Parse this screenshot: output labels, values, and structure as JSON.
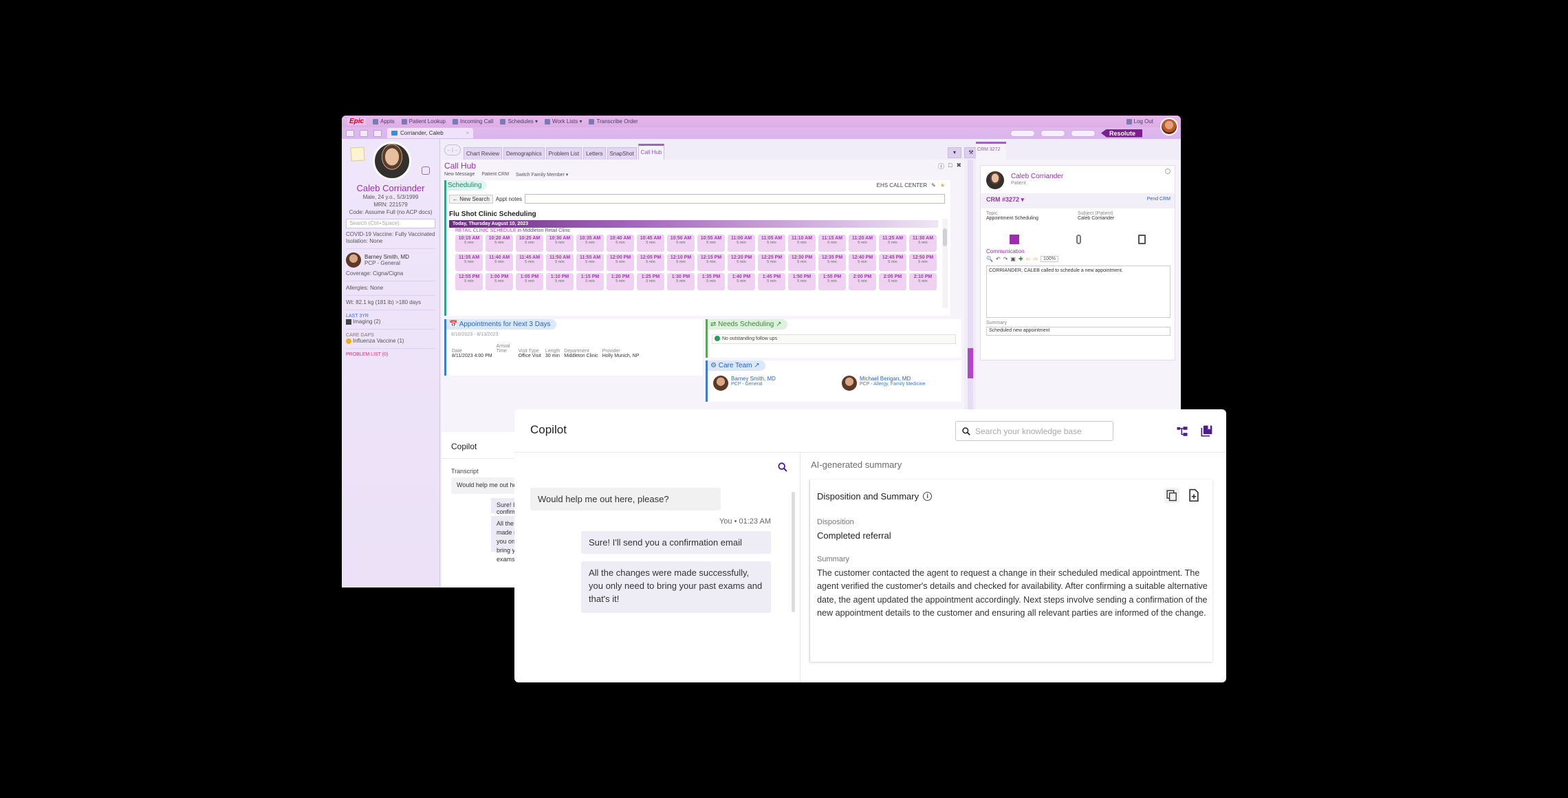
{
  "epic": {
    "menubar": {
      "logo": "Epic",
      "items": [
        "Appts",
        "Patient Lookup",
        "Incoming Call",
        "Schedules ▾",
        "Work Lists ▾",
        "Transcribe Order"
      ],
      "logout": "Log Out",
      "resolute": "Resolute"
    },
    "patient_tab": {
      "label": "Corriander, Caleb",
      "close": "×"
    },
    "sidebar": {
      "name": "Caleb Corriander",
      "demo": "Male, 24 y.o., 5/3/1999",
      "mrn": "MRN: 221579",
      "code": "Code: Assume Full (no ACP docs)",
      "search_placeholder": "Search (Ctrl+Space)",
      "covid": "COVID-19 Vaccine: Fully Vaccinated",
      "isolation": "Isolation: None",
      "pcp_name": "Barney Smith, MD",
      "pcp_role": "PCP - General",
      "coverage": "Coverage: Cigna/Cigna",
      "allergies": "Allergies: None",
      "weight": "Wt:  82.1 kg (181 lb) >180 days",
      "last_label": "LAST 3YR",
      "imaging": "Imaging (2)",
      "care_gaps_label": "CARE GAPS",
      "influenza": "Influenza Vaccine (1)",
      "problem_list": "PROBLEM LIST (0)"
    },
    "activity_tabs": [
      "Chart Review",
      "Demographics",
      "Problem List",
      "Letters",
      "SnapShot",
      "Call Hub"
    ],
    "active_tab": "Call Hub",
    "callhub": {
      "title": "Call Hub",
      "toolbar": [
        "New Message",
        "Patient CRM",
        "Switch Family Member ▾"
      ],
      "scheduling": {
        "header": "Scheduling",
        "center": "EHS CALL CENTER",
        "new_search": "← New Search",
        "appt_notes_label": "Appt notes",
        "flu_title": "Flu Shot Clinic Scheduling",
        "day": "Today, Thursday August 10, 2023",
        "clinic_schedule": "RETAIL CLINIC SCHEDULE",
        "clinic_loc": " in Middleton Retail Clinic",
        "slot_length": "5 min",
        "slots": [
          "10:15 AM",
          "10:20 AM",
          "10:25 AM",
          "10:30 AM",
          "10:35 AM",
          "10:40 AM",
          "10:45 AM",
          "10:50 AM",
          "10:55 AM",
          "11:00 AM",
          "11:05 AM",
          "11:10 AM",
          "11:15 AM",
          "11:20 AM",
          "11:25 AM",
          "11:30 AM",
          "11:35 AM",
          "11:40 AM",
          "11:45 AM",
          "11:50 AM",
          "11:55 AM",
          "12:00 PM",
          "12:05 PM",
          "12:10 PM",
          "12:15 PM",
          "12:20 PM",
          "12:25 PM",
          "12:30 PM",
          "12:35 PM",
          "12:40 PM",
          "12:45 PM",
          "12:50 PM",
          "12:55 PM",
          "1:00 PM",
          "1:05 PM",
          "1:10 PM",
          "1:15 PM",
          "1:20 PM",
          "1:25 PM",
          "1:30 PM",
          "1:35 PM",
          "1:40 PM",
          "1:45 PM",
          "1:50 PM",
          "1:55 PM",
          "2:00 PM",
          "2:05 PM",
          "2:10 PM"
        ]
      },
      "appointments": {
        "header": "Appointments for Next 3 Days",
        "range": "8/10/2023 - 8/13/2023",
        "columns": [
          "Date",
          "Arrival Time",
          "Visit Type",
          "Length",
          "Department",
          "Provider"
        ],
        "rows": [
          [
            "8/11/2023  4:00 PM",
            "",
            "Office Visit",
            "30 min",
            "Middleton Clinic",
            "Holly Munich, NP"
          ]
        ]
      },
      "needs_scheduling": {
        "header": "Needs Scheduling",
        "message": "No outstanding follow ups"
      },
      "care_team": {
        "header": "Care Team",
        "members": [
          {
            "name": "Barney Smith, MD",
            "role": "PCP - General"
          },
          {
            "name": "Michael Berigan, MD",
            "role": "PCP - Allergy, Family Medicine"
          }
        ]
      }
    },
    "crm": {
      "tab": "CRM 3272",
      "patient_name": "Caleb Corriander",
      "patient_role": "Patient",
      "crm_id": "CRM #3272 ▾",
      "pend": "Pend CRM",
      "topic_label": "Topic",
      "topic_value": "Appointment Scheduling",
      "subject_label": "Subject (Patient)",
      "subject_value": "Caleb Corriander",
      "communication_label": "Communication",
      "zoom": "100%",
      "note": "CORRIANDER, CALEB called to schedule a new appointment.",
      "summary_label": "Summary",
      "summary_value": "Scheduled new appointment"
    },
    "copilot_under": {
      "title": "Copilot",
      "transcript": "Transcript",
      "msg1": "Would help me out here, please?",
      "msg2": "Sure! I'll send you a confirmation email",
      "msg3": "All the changes were made successfully, you only need to bring your past exams and that's it!"
    }
  },
  "copilot": {
    "title": "Copilot",
    "search_placeholder": "Search your knowledge base",
    "messages": [
      {
        "from": "customer",
        "text": "Would help me out here, please?"
      },
      {
        "from": "you",
        "meta": "You • 01:23 AM",
        "text": "Sure! I'll send you a confirmation email"
      },
      {
        "from": "you",
        "text": "All the changes were made successfully, you only need to bring your past exams and that's it!"
      }
    ],
    "ai_label": "AI-generated summary",
    "card": {
      "title": "Disposition and Summary",
      "disposition_label": "Disposition",
      "disposition_value": "Completed referral",
      "summary_label": "Summary",
      "summary_value": "The customer contacted the agent to request a change in their  scheduled medical appointment. The agent verified the customer's details  and checked for availability. After confirming a suitable alternative  date, the agent updated the appointment accordingly. Next steps involve  sending a confirmation of the new appointment details to the customer  and ensuring all relevant parties are informed of the change."
    },
    "colors": {
      "accent": "#4b1d8f",
      "epic_purple": "#9b2fae"
    }
  }
}
